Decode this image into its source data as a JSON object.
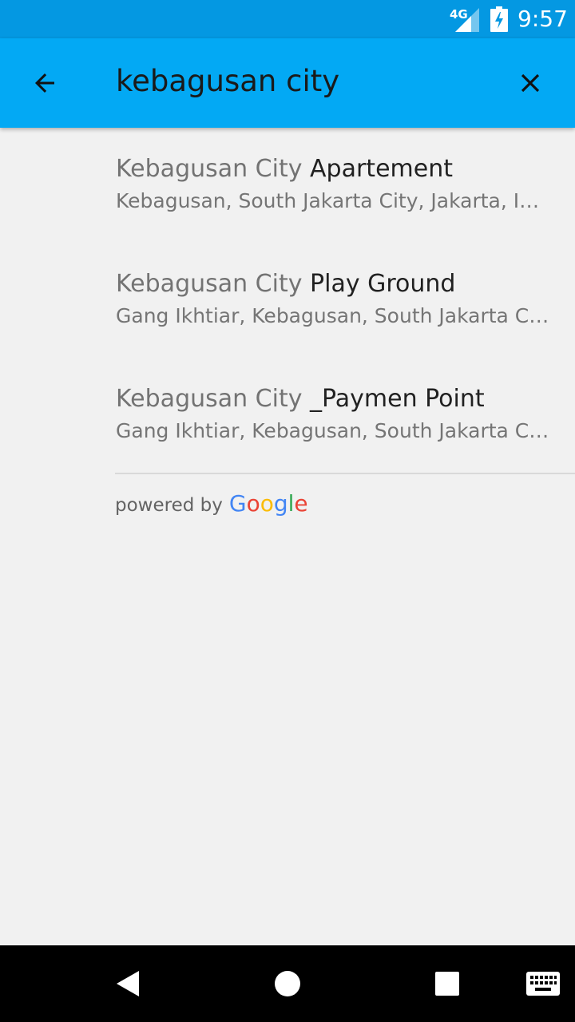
{
  "status_bar": {
    "network": "4G",
    "time": "9:57",
    "icons": [
      "signal-icon",
      "battery-charging-icon"
    ]
  },
  "toolbar": {
    "query": "kebagusan city",
    "back_icon": "arrow-back-icon",
    "clear_icon": "close-icon",
    "background": "#03a9f4"
  },
  "results": [
    {
      "match": "Kebagusan City",
      "rest": " Apartement",
      "address": "Kebagusan, South Jakarta City, Jakarta, Indonesia"
    },
    {
      "match": "Kebagusan City",
      "rest": " Play Ground",
      "address": "Gang Ikhtiar, Kebagusan, South Jakarta City, Jakarta, Indonesia"
    },
    {
      "match": "Kebagusan City",
      "rest": " _Paymen Point",
      "address": "Gang Ikhtiar, Kebagusan, South Jakarta City, Jakarta, Indonesia"
    }
  ],
  "attribution": {
    "prefix": "powered by",
    "brand_letters": [
      "G",
      "o",
      "o",
      "g",
      "l",
      "e"
    ],
    "brand_colors": [
      "#4285f4",
      "#ea4335",
      "#fbbc05",
      "#4285f4",
      "#34a853",
      "#ea4335"
    ]
  },
  "nav_bar": {
    "icons": [
      "back-triangle-icon",
      "home-circle-icon",
      "recents-square-icon",
      "keyboard-icon"
    ]
  }
}
